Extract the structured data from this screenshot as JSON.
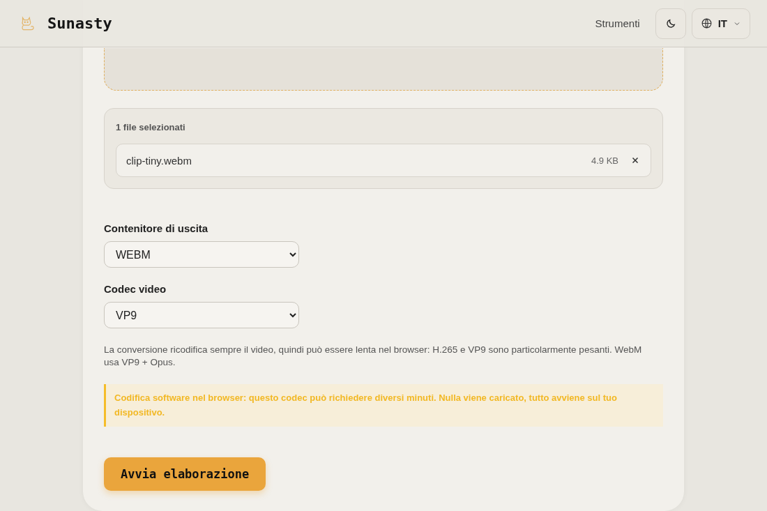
{
  "header": {
    "brand": "Sunasty",
    "nav_link": "Strumenti",
    "language": "IT"
  },
  "selected_files": {
    "title": "1 file selezionati",
    "files": [
      {
        "name": "clip-tiny.webm",
        "size": "4.9 KB"
      }
    ]
  },
  "fields": [
    {
      "label": "Contenitore di uscita",
      "value": "WEBM"
    },
    {
      "label": "Codec video",
      "value": "VP9"
    }
  ],
  "note": "La conversione ricodifica sempre il video, quindi può essere lenta nel browser: H.265 e VP9 sono particolarmente pesanti. WebM usa VP9 + Opus.",
  "warning": "Codifica software nel browser: questo codec può richiedere diversi minuti. Nulla viene caricato, tutto avviene sul tuo dispositivo.",
  "start_button": "Avvia elaborazione"
}
